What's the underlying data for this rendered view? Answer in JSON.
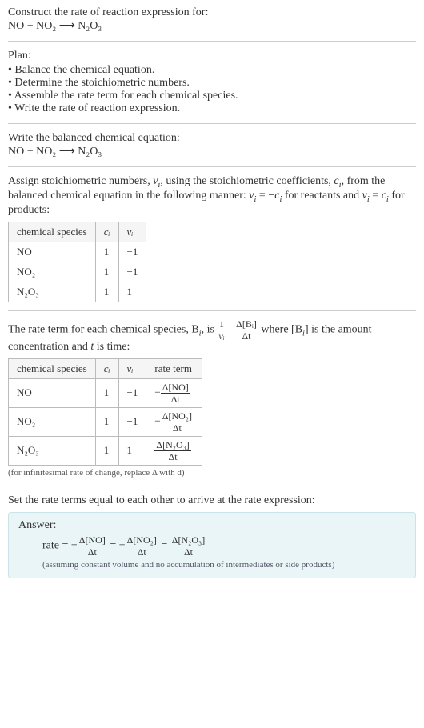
{
  "title": "Construct the rate of reaction expression for:",
  "equation_unbalanced": "NO + NO₂ ⟶ N₂O₃",
  "plan_heading": "Plan:",
  "plan_items": [
    "Balance the chemical equation.",
    "Determine the stoichiometric numbers.",
    "Assemble the rate term for each chemical species.",
    "Write the rate of reaction expression."
  ],
  "balanced_heading": "Write the balanced chemical equation:",
  "equation_balanced": "NO + NO₂ ⟶ N₂O₃",
  "stoich_intro_a": "Assign stoichiometric numbers, ",
  "stoich_intro_nu": "ν",
  "stoich_intro_i": "i",
  "stoich_intro_b": ", using the stoichiometric coefficients, ",
  "stoich_intro_c": "c",
  "stoich_intro_d": ", from the balanced chemical equation in the following manner: ",
  "stoich_intro_e": " = −",
  "stoich_intro_f": " for reactants and ",
  "stoich_intro_g": " = ",
  "stoich_intro_h": " for products:",
  "table1": {
    "headers": {
      "species": "chemical species",
      "ci": "cᵢ",
      "nui": "νᵢ"
    },
    "rows": [
      {
        "species": "NO",
        "ci": "1",
        "nui": "−1"
      },
      {
        "species": "NO₂",
        "ci": "1",
        "nui": "−1"
      },
      {
        "species": "N₂O₃",
        "ci": "1",
        "nui": "1"
      }
    ]
  },
  "rateterm_a": "The rate term for each chemical species, B",
  "rateterm_b": ", is ",
  "rateterm_frac1_num": "1",
  "rateterm_frac1_den": "νᵢ",
  "rateterm_frac2_num": "Δ[Bᵢ]",
  "rateterm_frac2_den": "Δt",
  "rateterm_c": " where [B",
  "rateterm_d": "] is the amount concentration and ",
  "rateterm_t": "t",
  "rateterm_e": " is time:",
  "table2": {
    "headers": {
      "species": "chemical species",
      "ci": "cᵢ",
      "nui": "νᵢ",
      "rate": "rate term"
    },
    "rows": [
      {
        "species": "NO",
        "ci": "1",
        "nui": "−1",
        "rate_neg": "−",
        "rate_num": "Δ[NO]",
        "rate_den": "Δt"
      },
      {
        "species": "NO₂",
        "ci": "1",
        "nui": "−1",
        "rate_neg": "−",
        "rate_num": "Δ[NO₂]",
        "rate_den": "Δt"
      },
      {
        "species": "N₂O₃",
        "ci": "1",
        "nui": "1",
        "rate_neg": "",
        "rate_num": "Δ[N₂O₃]",
        "rate_den": "Δt"
      }
    ]
  },
  "infinitesimal_note": "(for infinitesimal rate of change, replace Δ with d)",
  "set_equal": "Set the rate terms equal to each other to arrive at the rate expression:",
  "answer_label": "Answer:",
  "answer_rate": "rate = ",
  "answer_neg": "−",
  "answer_terms": [
    {
      "neg": "−",
      "num": "Δ[NO]",
      "den": "Δt"
    },
    {
      "neg": "−",
      "num": "Δ[NO₂]",
      "den": "Δt"
    },
    {
      "neg": "",
      "num": "Δ[N₂O₃]",
      "den": "Δt"
    }
  ],
  "answer_eq": " = ",
  "answer_assume": "(assuming constant volume and no accumulation of intermediates or side products)"
}
